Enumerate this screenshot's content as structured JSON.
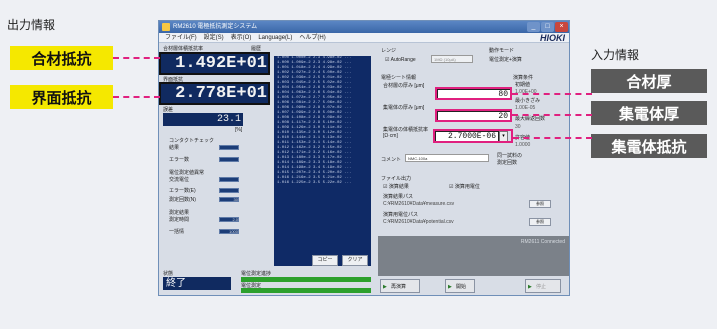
{
  "captions": {
    "output": "出力情報",
    "input": "入力情報"
  },
  "labels": {
    "mix_resistance": "合材抵抗",
    "interface_resistance": "界面抵抗",
    "mix_thickness": "合材厚",
    "collector_thickness": "集電体厚",
    "collector_resistance": "集電体抵抗"
  },
  "window": {
    "title": "RM2610 電極抵抗測定システム",
    "close": "×",
    "min": "_",
    "max": "□"
  },
  "menu": [
    "ファイル(F)",
    "設定(S)",
    "表示(O)",
    "Language(L)",
    "ヘルプ(H)"
  ],
  "brand": "HIOKI",
  "results": {
    "header1": "合材層体積抵抗率",
    "header2": "界面抵抗",
    "history": "履歴",
    "mix_value": "1.492E+01",
    "interface_value": "2.778E+01",
    "third_label": "誤差",
    "third_value": "23.1",
    "unit": "[%]"
  },
  "checks": {
    "contact_check": "コンタクトチェック",
    "result": "結果",
    "error_count": "エラー数",
    "potential_abnormal": "電位測定値異常",
    "ac_label": "交流電位",
    "error_lbl": "エラー数(E)",
    "count": "測定回数(N)",
    "count_val": "30",
    "time_header": "測定結果",
    "time_label": "測定時間",
    "time_val": "2.0",
    "single": "一括情",
    "single_val": "1000"
  },
  "log_lines": [
    "1.000 1.000e-2 2.3 4.98e-02 ...",
    "1.000 1.009e-2 2.3 4.98e-02 ...",
    "1.001 1.018e-2 2.4 4.99e-02 ...",
    "1.002 1.027e-2 2.4 5.00e-02 ...",
    "1.002 1.036e-2 2.5 5.01e-02 ...",
    "1.003 1.045e-2 2.5 5.02e-02 ...",
    "1.004 1.054e-2 2.6 5.03e-02 ...",
    "1.004 1.063e-2 2.6 5.04e-02 ...",
    "1.005 1.072e-2 2.7 5.05e-02 ...",
    "1.006 1.081e-2 2.7 5.06e-02 ...",
    "1.006 1.090e-2 2.8 5.07e-02 ...",
    "1.007 1.099e-2 2.8 5.08e-02 ...",
    "1.008 1.108e-2 2.9 5.09e-02 ...",
    "1.008 1.117e-2 2.9 5.10e-02 ...",
    "1.009 1.126e-2 3.0 5.11e-02 ...",
    "1.010 1.135e-2 3.0 5.12e-02 ...",
    "1.010 1.144e-2 3.1 5.13e-02 ...",
    "1.011 1.153e-2 3.1 5.14e-02 ...",
    "1.012 1.162e-2 3.2 5.15e-02 ...",
    "1.012 1.171e-2 3.2 5.16e-02 ...",
    "1.013 1.180e-2 3.3 5.17e-02 ...",
    "1.014 1.189e-2 3.3 5.18e-02 ...",
    "1.014 1.198e-2 3.4 5.19e-02 ...",
    "1.015 1.207e-2 3.4 5.20e-02 ...",
    "1.016 1.216e-2 3.5 5.21e-02 ...",
    "1.016 1.225e-2 3.5 5.22e-02 ..."
  ],
  "buttons": {
    "copy": "コピー",
    "clear": "クリア",
    "recalc": "再演算",
    "start": "開始",
    "stop": "停止"
  },
  "status": {
    "label": "状態",
    "value": "終了",
    "progress_label": "電位測定進捗",
    "progress1": "電位測定",
    "progress2": "測定進捗"
  },
  "range": {
    "header": "レンジ",
    "auto": "AutoRange",
    "value": "1MΩ (10μA)"
  },
  "mode": {
    "header": "動作モード",
    "value": "電位測定+演算"
  },
  "sheet": {
    "header": "電極シート情報",
    "mix_label": "合材層の厚み [μm]",
    "mix_value": "80",
    "col_label": "集電体の厚み [μm]",
    "col_value": "20",
    "res_label": "集電体の体積抵抗率 [Ω·cm]",
    "res_value": "2.7000E-06"
  },
  "conditions": {
    "header": "演算条件",
    "l1": "初期値",
    "l2": "1.00E+00",
    "l3": "最小きざみ",
    "l4": "1.00E-05",
    "l5": "最大繰返回数",
    "l6": "30",
    "l7": "許容値",
    "l8": "1.0000"
  },
  "comment": {
    "label": "コメント",
    "value": "NMC-100a",
    "note1": "同一試料の",
    "note2": "測定回数"
  },
  "file": {
    "header": "ファイル出力",
    "cb1": "演算結果",
    "cb2": "演算用電位",
    "path_label1": "演算結果パス",
    "path1": "C:¥RM2610¥Data¥measure.csv",
    "path_label2": "演算用電位パス",
    "path2": "C:¥RM2610¥Data¥potential.csv",
    "ref": "参照"
  },
  "connection": "RM2611 Connected"
}
